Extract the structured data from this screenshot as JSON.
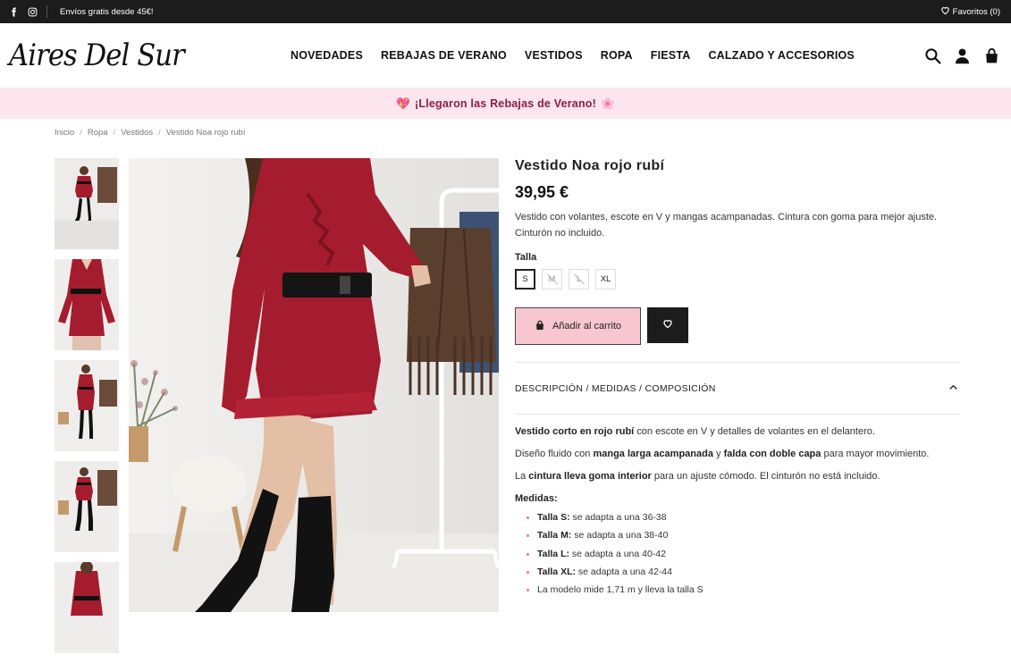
{
  "topbar": {
    "shipping": "Envíos gratis desde 45€!",
    "favorites": "Favoritos (0)",
    "icons": [
      "facebook-icon",
      "instagram-icon",
      "heart-icon"
    ]
  },
  "header": {
    "logo": "Aires Del Sur",
    "nav": [
      "NOVEDADES",
      "REBAJAS DE VERANO",
      "VESTIDOS",
      "ROPA",
      "FIESTA",
      "CALZADO Y ACCESORIOS"
    ],
    "icons": [
      "search-icon",
      "user-icon",
      "bag-icon"
    ]
  },
  "promo": {
    "emoji_left": "💖",
    "text": "¡Llegaron las Rebajas de Verano!",
    "emoji_right": "🌸"
  },
  "breadcrumb": [
    "Inicio",
    "Ropa",
    "Vestidos",
    "Vestido Noa rojo rubí"
  ],
  "product": {
    "title": "Vestido Noa rojo rubí",
    "price": "39,95 €",
    "description": "Vestido con volantes, escote en V y mangas acampanadas. Cintura con goma para mejor ajuste. Cinturón no incluido.",
    "size_label": "Talla",
    "sizes": [
      {
        "label": "S",
        "selected": true,
        "available": true
      },
      {
        "label": "M",
        "selected": false,
        "available": false
      },
      {
        "label": "L",
        "selected": false,
        "available": false
      },
      {
        "label": "XL",
        "selected": false,
        "available": true
      }
    ],
    "add_to_cart": "Añadir al carrito",
    "accordion_title": "DESCRIPCIÓN / MEDIDAS / COMPOSICIÓN",
    "details": {
      "p1_bold": "Vestido corto en rojo rubí",
      "p1_rest": " con escote en V y detalles de volantes en el delantero.",
      "p2_a": "Diseño fluido con ",
      "p2_b": "manga larga acampanada",
      "p2_c": " y ",
      "p2_d": "falda con doble capa",
      "p2_e": " para mayor movimiento.",
      "p3_a": "La ",
      "p3_b": "cintura lleva goma interior",
      "p3_c": " para un ajuste cómodo. El cinturón no está incluido.",
      "measures_title": "Medidas:",
      "measures": [
        {
          "label": "Talla S:",
          "text": " se adapta a una 36-38"
        },
        {
          "label": "Talla M:",
          "text": " se adapta a una 38-40"
        },
        {
          "label": "Talla L:",
          "text": " se adapta a una 40-42"
        },
        {
          "label": "Talla XL:",
          "text": " se adapta a una 42-44"
        },
        {
          "label": "",
          "text": "La modelo mide 1,71 m y lleva la talla S"
        }
      ]
    }
  },
  "colors": {
    "accent_pink": "#f8c6cf",
    "promo_bg": "#fce5ec",
    "promo_text": "#8a1e44",
    "dress_red": "#a51c2e",
    "dark": "#1c1c1c"
  }
}
